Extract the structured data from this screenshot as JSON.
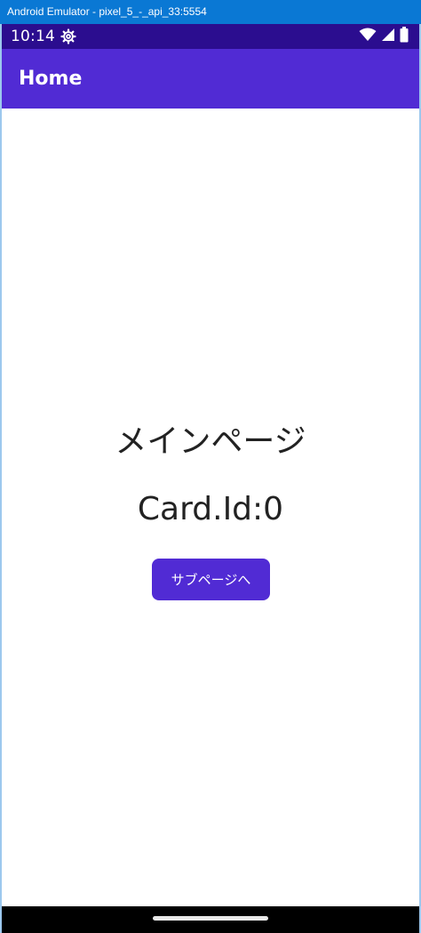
{
  "window": {
    "title": "Android Emulator - pixel_5_-_api_33:5554"
  },
  "statusbar": {
    "time": "10:14",
    "icons": [
      "gear-icon",
      "wifi-icon",
      "cellular-signal-icon",
      "battery-icon"
    ]
  },
  "appbar": {
    "title": "Home"
  },
  "main": {
    "title": "メインページ",
    "card_id": "Card.Id:0",
    "sub_button_label": "サブページへ"
  },
  "colors": {
    "accent": "#512bd4",
    "statusbar": "#2b0d8f",
    "titlebar": "#0a78d4"
  }
}
